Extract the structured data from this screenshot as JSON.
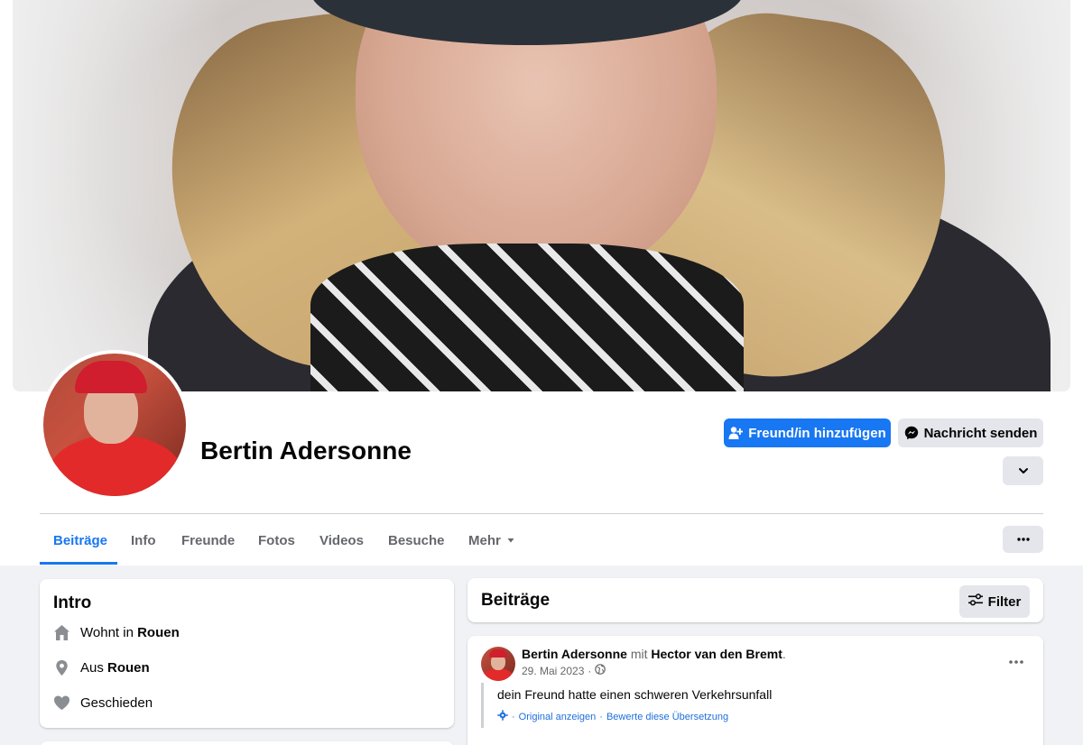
{
  "profile": {
    "name": "Bertin Adersonne"
  },
  "actions": {
    "add_friend": "Freund/in hinzufügen",
    "message": "Nachricht senden"
  },
  "tabs": [
    {
      "label": "Beiträge",
      "active": true
    },
    {
      "label": "Info"
    },
    {
      "label": "Freunde"
    },
    {
      "label": "Fotos"
    },
    {
      "label": "Videos"
    },
    {
      "label": "Besuche"
    },
    {
      "label": "Mehr"
    }
  ],
  "intro": {
    "title": "Intro",
    "lives_prefix": "Wohnt in ",
    "lives_city": "Rouen",
    "from_prefix": "Aus ",
    "from_city": "Rouen",
    "relationship": "Geschieden"
  },
  "posts": {
    "title": "Beiträge",
    "filter_label": "Filter",
    "items": [
      {
        "author": "Bertin Adersonne",
        "with_word": "mit",
        "tagged": "Hector van den Bremt",
        "date": "29. Mai 2023",
        "text": "dein Freund hatte einen schweren Verkehrsunfall",
        "show_original": "Original anzeigen",
        "rate_translation": "Bewerte diese Übersetzung"
      }
    ]
  },
  "colors": {
    "accent": "#1877f2",
    "page_bg": "#f0f2f5",
    "secondary_button": "#e4e6eb",
    "muted_text": "#65676b"
  }
}
